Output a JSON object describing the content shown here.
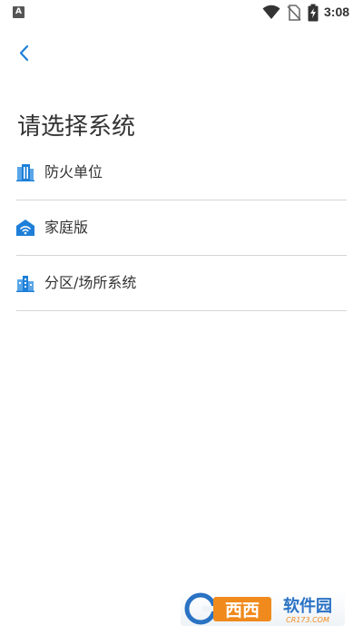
{
  "status_bar": {
    "time": "3:08",
    "app_icon_letter": "A",
    "icons": [
      "wifi-icon",
      "no-sim-icon",
      "battery-charging-icon"
    ]
  },
  "header": {
    "back_icon": "chevron-left-icon"
  },
  "page": {
    "title": "请选择系统"
  },
  "systems": [
    {
      "label": "防火单位",
      "icon": "building-icon"
    },
    {
      "label": "家庭版",
      "icon": "home-wifi-icon"
    },
    {
      "label": "分区/场所系统",
      "icon": "city-buildings-icon"
    }
  ],
  "watermark": {
    "text": "西西软件园",
    "subtext": "CR173.COM"
  },
  "colors": {
    "accent": "#1e7fd9",
    "text": "#333333",
    "divider": "#d6d6d6",
    "background": "#ffffff"
  }
}
